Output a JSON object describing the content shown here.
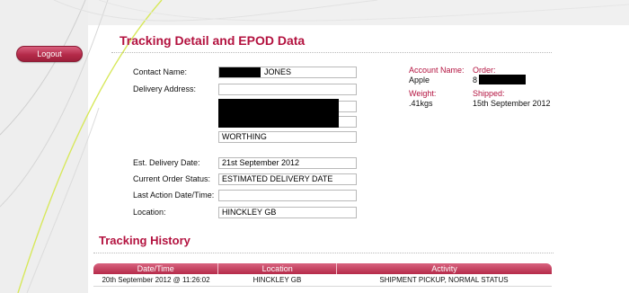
{
  "nav": {
    "logout_label": "Logout"
  },
  "detail": {
    "title": "Tracking Detail and EPOD Data",
    "contact_label": "Contact Name:",
    "contact_value": "JONES",
    "address_label": "Delivery Address:",
    "address_line1": "",
    "address_city": "WORTHING",
    "est_delivery_label": "Est. Delivery Date:",
    "est_delivery_value": "21st September 2012",
    "status_label": "Current Order Status:",
    "status_value": "ESTIMATED DELIVERY DATE",
    "last_action_label": "Last Action Date/Time:",
    "last_action_value": "",
    "location_label": "Location:",
    "location_value": "HINCKLEY GB"
  },
  "account": {
    "account_name_label": "Account Name:",
    "account_name_value": "Apple",
    "order_label": "Order:",
    "order_value": "8",
    "weight_label": "Weight:",
    "weight_value": ".41kgs",
    "shipped_label": "Shipped:",
    "shipped_value": "15th September 2012"
  },
  "history": {
    "title": "Tracking History",
    "columns": [
      "Date/Time",
      "Location",
      "Activity"
    ],
    "rows": [
      [
        "20th September 2012 @ 11:26:02",
        "HINCKLEY GB",
        "SHIPMENT PICKUP, NORMAL STATUS"
      ]
    ]
  },
  "colors": {
    "accent": "#b3123f",
    "button": "#b52b4a"
  }
}
